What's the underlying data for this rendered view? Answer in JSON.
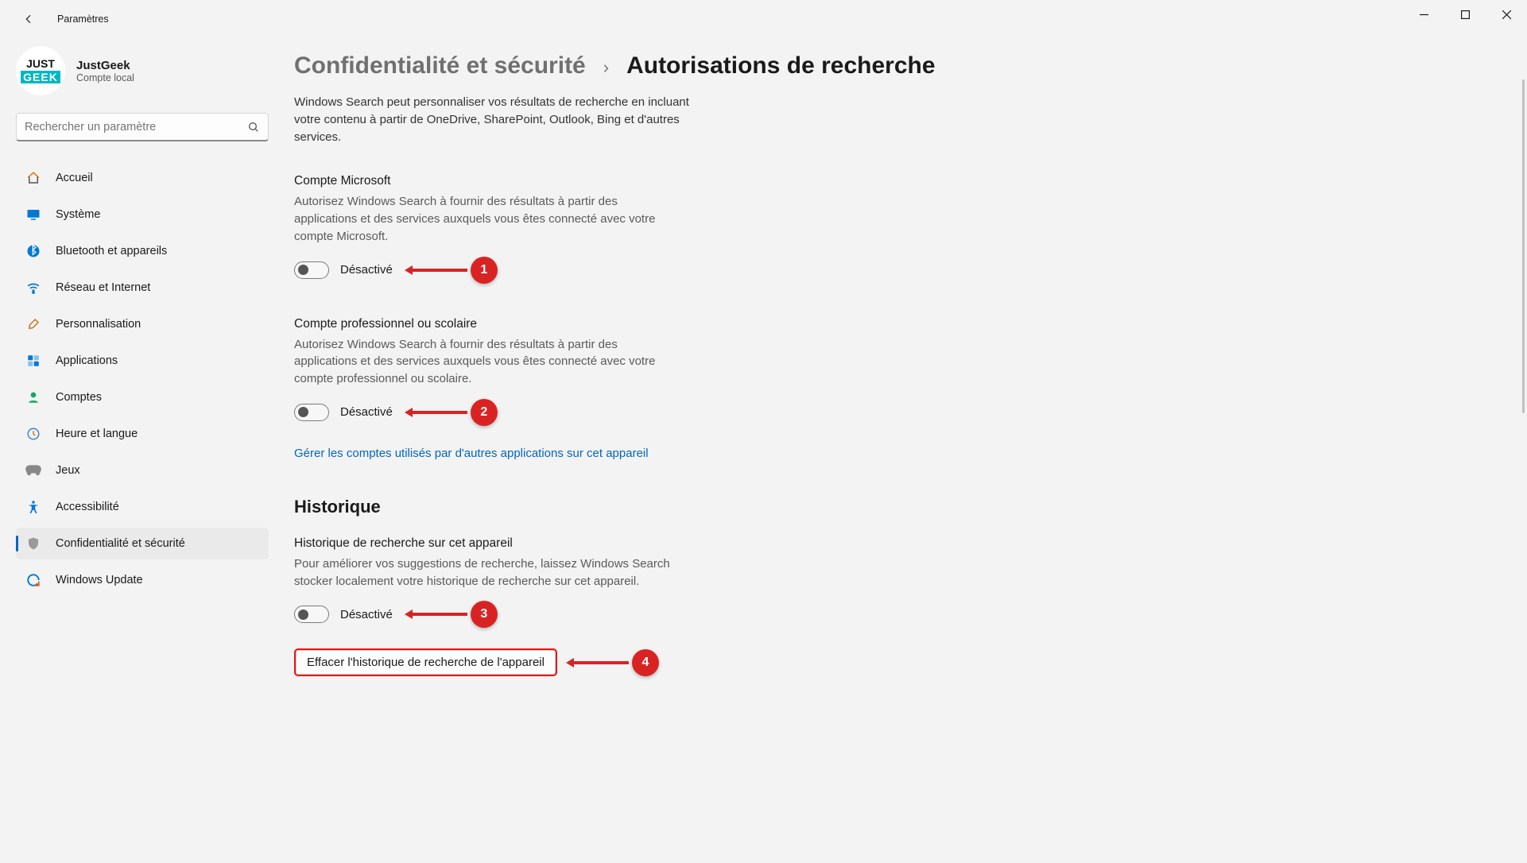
{
  "app_title": "Paramètres",
  "window_controls": {
    "min": "min",
    "max": "max",
    "close": "close"
  },
  "profile": {
    "name": "JustGeek",
    "subtitle": "Compte local",
    "logo_line1": "JUST",
    "logo_line2": "GEEK"
  },
  "search": {
    "placeholder": "Rechercher un paramètre"
  },
  "nav": {
    "items": [
      {
        "label": "Accueil",
        "icon": "home"
      },
      {
        "label": "Système",
        "icon": "system"
      },
      {
        "label": "Bluetooth et appareils",
        "icon": "bluetooth"
      },
      {
        "label": "Réseau et Internet",
        "icon": "wifi"
      },
      {
        "label": "Personnalisation",
        "icon": "brush"
      },
      {
        "label": "Applications",
        "icon": "apps"
      },
      {
        "label": "Comptes",
        "icon": "person"
      },
      {
        "label": "Heure et langue",
        "icon": "clock"
      },
      {
        "label": "Jeux",
        "icon": "gamepad"
      },
      {
        "label": "Accessibilité",
        "icon": "accessibility"
      },
      {
        "label": "Confidentialité et sécurité",
        "icon": "shield",
        "active": true
      },
      {
        "label": "Windows Update",
        "icon": "update"
      }
    ]
  },
  "breadcrumb": {
    "parent": "Confidentialité et sécurité",
    "sep": "›",
    "current": "Autorisations de recherche"
  },
  "intro": "Windows Search peut personnaliser vos résultats de recherche en incluant votre contenu à partir de OneDrive, SharePoint, Outlook, Bing et d'autres services.",
  "sections": {
    "ms_account": {
      "title": "Compte Microsoft",
      "desc": "Autorisez Windows Search à fournir des résultats à partir des applications et des services auxquels vous êtes connecté avec votre compte Microsoft.",
      "toggle_label": "Désactivé",
      "anno": "1"
    },
    "work_account": {
      "title": "Compte professionnel ou scolaire",
      "desc": "Autorisez Windows Search à fournir des résultats à partir des applications et des services auxquels vous êtes connecté avec votre compte professionnel ou scolaire.",
      "toggle_label": "Désactivé",
      "anno": "2"
    },
    "link": "Gérer les comptes utilisés par d'autres applications sur cet appareil",
    "history_heading": "Historique",
    "device_history": {
      "title": "Historique de recherche sur cet appareil",
      "desc": "Pour améliorer vos suggestions de recherche, laissez Windows Search stocker localement votre historique de recherche sur cet appareil.",
      "toggle_label": "Désactivé",
      "anno": "3"
    },
    "clear_btn": {
      "label": "Effacer l'historique de recherche de l'appareil",
      "anno": "4"
    }
  }
}
